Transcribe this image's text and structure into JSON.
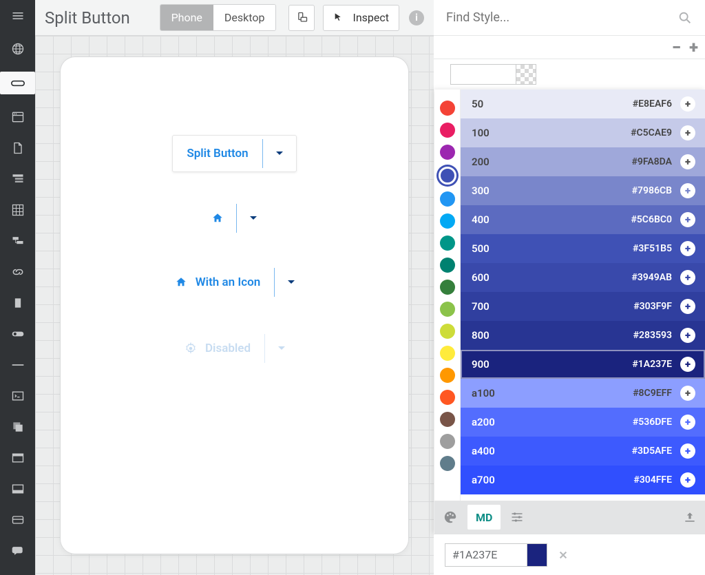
{
  "header": {
    "title": "Split Button",
    "view_tabs": {
      "phone": "Phone",
      "desktop": "Desktop"
    },
    "inspect": "Inspect"
  },
  "canvas": {
    "btn1": {
      "label": "Split Button"
    },
    "btn3": {
      "label": "With an Icon"
    },
    "btn4": {
      "label": "Disabled"
    }
  },
  "right": {
    "find_placeholder": "Find Style...",
    "md_label": "MD",
    "hex_input": "#1A237E"
  },
  "palette": {
    "hues": [
      {
        "color": "#F44336"
      },
      {
        "color": "#E91E63"
      },
      {
        "color": "#9C27B0"
      },
      {
        "color": "#3F51B5",
        "selected": true
      },
      {
        "color": "#2196F3"
      },
      {
        "color": "#03A9F4"
      },
      {
        "color": "#009688"
      },
      {
        "color": "#008170"
      },
      {
        "color": "#357F3C"
      },
      {
        "color": "#8BC34A"
      },
      {
        "color": "#CDDC39"
      },
      {
        "color": "#FFEB3B"
      },
      {
        "color": "#FF9800"
      },
      {
        "color": "#FF5722"
      },
      {
        "color": "#795548"
      },
      {
        "color": "#9E9E9E"
      },
      {
        "color": "#607D8B"
      }
    ],
    "shades": [
      {
        "name": "50",
        "hex": "#E8EAF6",
        "dark": true
      },
      {
        "name": "100",
        "hex": "#C5CAE9",
        "dark": true
      },
      {
        "name": "200",
        "hex": "#9FA8DA",
        "dark": true
      },
      {
        "name": "300",
        "hex": "#7986CB"
      },
      {
        "name": "400",
        "hex": "#5C6BC0"
      },
      {
        "name": "500",
        "hex": "#3F51B5"
      },
      {
        "name": "600",
        "hex": "#3949AB"
      },
      {
        "name": "700",
        "hex": "#303F9F"
      },
      {
        "name": "800",
        "hex": "#283593"
      },
      {
        "name": "900",
        "hex": "#1A237E",
        "selected": true
      },
      {
        "name": "a100",
        "hex": "#8C9EFF",
        "dark": true
      },
      {
        "name": "a200",
        "hex": "#536DFE"
      },
      {
        "name": "a400",
        "hex": "#3D5AFE"
      },
      {
        "name": "a700",
        "hex": "#304FFE"
      }
    ]
  }
}
